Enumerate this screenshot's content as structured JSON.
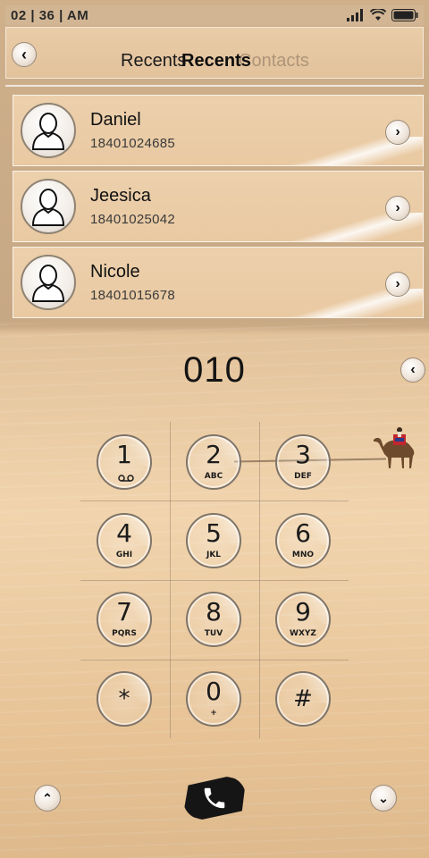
{
  "status_bar": {
    "time": "02 | 36 | AM",
    "icons": [
      "signal-icon",
      "wifi-icon",
      "battery-icon"
    ]
  },
  "header": {
    "back_icon": "chevron-left-icon",
    "tab_ghost_label": "Recents",
    "tab_active_label": "Recents",
    "tab_inactive_label": "Contacts"
  },
  "contacts": [
    {
      "name": "Daniel",
      "number": "18401024685"
    },
    {
      "name": "Jeesica",
      "number": "18401025042"
    },
    {
      "name": "Nicole",
      "number": "18401015678"
    }
  ],
  "dialer": {
    "display": "010",
    "backspace_icon": "chevron-left-icon",
    "keys": [
      {
        "digit": "1",
        "letters": "",
        "icon": "voicemail-icon"
      },
      {
        "digit": "2",
        "letters": "ABC"
      },
      {
        "digit": "3",
        "letters": "DEF"
      },
      {
        "digit": "4",
        "letters": "GHI"
      },
      {
        "digit": "5",
        "letters": "JKL"
      },
      {
        "digit": "6",
        "letters": "MNO"
      },
      {
        "digit": "7",
        "letters": "PQRS"
      },
      {
        "digit": "8",
        "letters": "TUV"
      },
      {
        "digit": "9",
        "letters": "WXYZ"
      },
      {
        "digit": "*",
        "letters": ""
      },
      {
        "digit": "0",
        "letters": "+"
      },
      {
        "digit": "#",
        "letters": ""
      }
    ]
  },
  "bottom_bar": {
    "left_icon": "chevron-up-icon",
    "call_icon": "phone-icon",
    "right_icon": "chevron-down-icon"
  },
  "colors": {
    "sand_light": "#f1d4ad",
    "card_bg": "#ecd0ac",
    "ink": "#111111"
  }
}
